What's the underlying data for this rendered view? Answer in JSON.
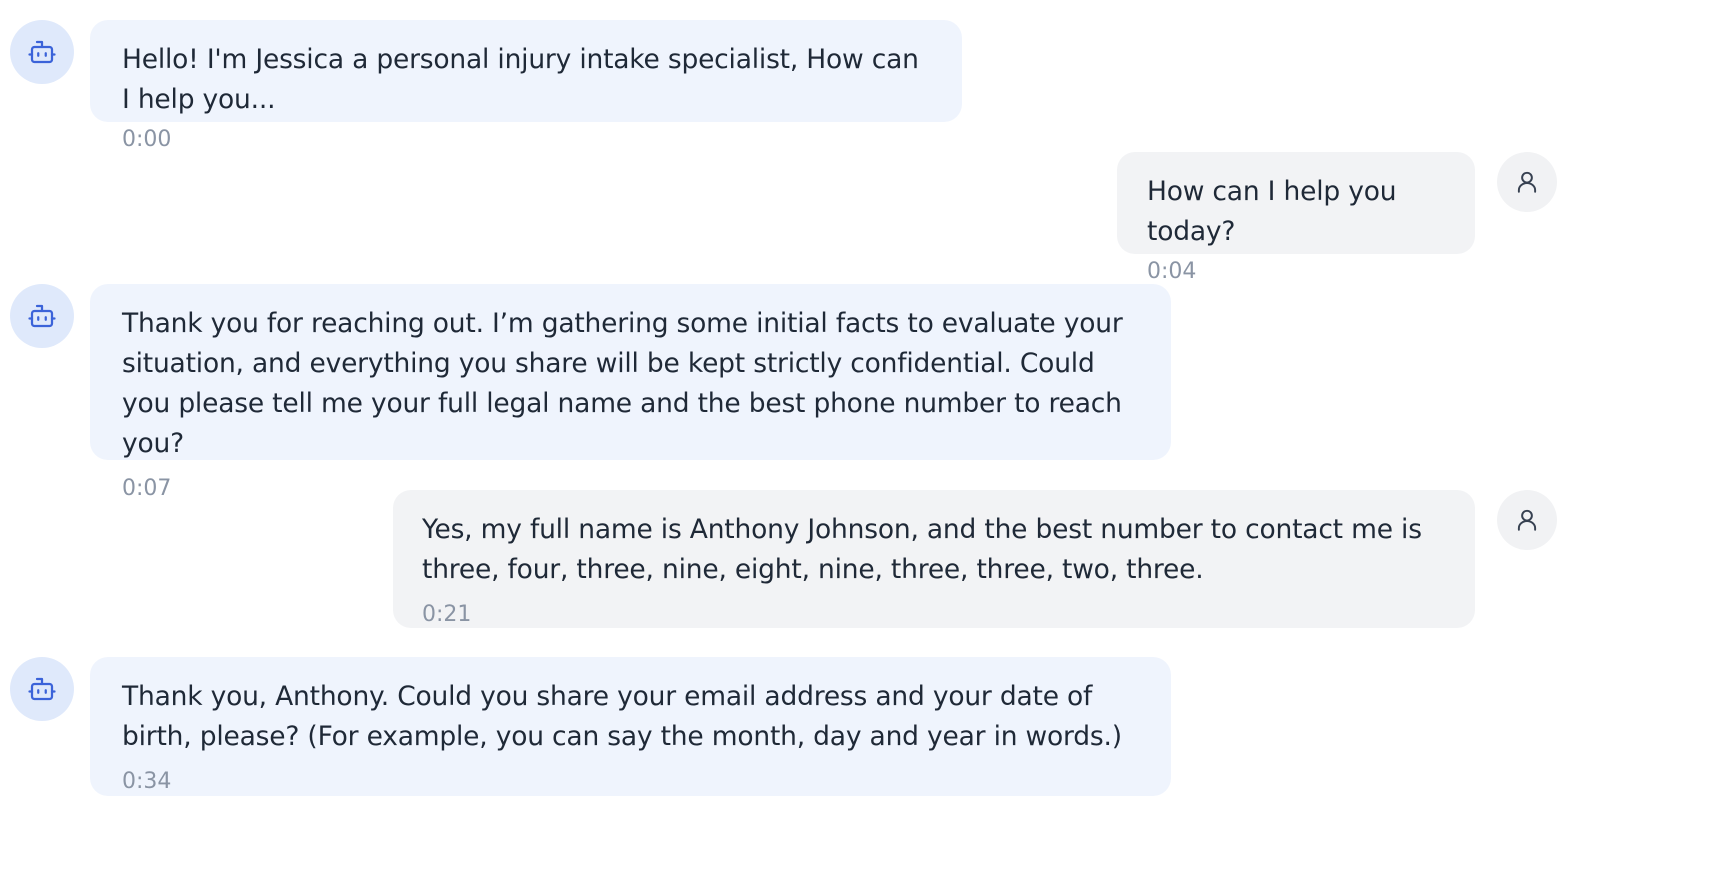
{
  "messages": [
    {
      "role": "bot",
      "text": "Hello! I'm Jessica a personal injury intake specialist, How can I help you...",
      "time": "0:00",
      "avatar_icon": "bot-icon"
    },
    {
      "role": "user",
      "text": "How can I help you today?",
      "time": "0:04",
      "avatar_icon": "user-icon"
    },
    {
      "role": "bot",
      "text": "Thank you for reaching out. I’m gathering some initial facts to evaluate your situation, and everything you share will be kept strictly confidential. Could you please tell me your full legal name and the best phone number to reach you?",
      "time": "0:07",
      "avatar_icon": "bot-icon"
    },
    {
      "role": "user",
      "text": "Yes, my full name is Anthony Johnson, and the best number to contact me is three, four, three, nine, eight, nine, three, three, two, three.",
      "time": "0:21",
      "avatar_icon": "user-icon"
    },
    {
      "role": "bot",
      "text": "Thank you, Anthony. Could you share your email address and your date of birth, please? (For example, you can say the month, day and year in words.)",
      "time": "0:34",
      "avatar_icon": "bot-icon"
    }
  ],
  "colors": {
    "bot_bubble": "#eff4fd",
    "user_bubble": "#f2f3f5",
    "bot_avatar_bg": "#dfe9fb",
    "user_avatar_bg": "#f1f2f4",
    "bot_icon": "#3b63d9",
    "user_icon": "#374151",
    "timestamp": "#8a94a4"
  }
}
